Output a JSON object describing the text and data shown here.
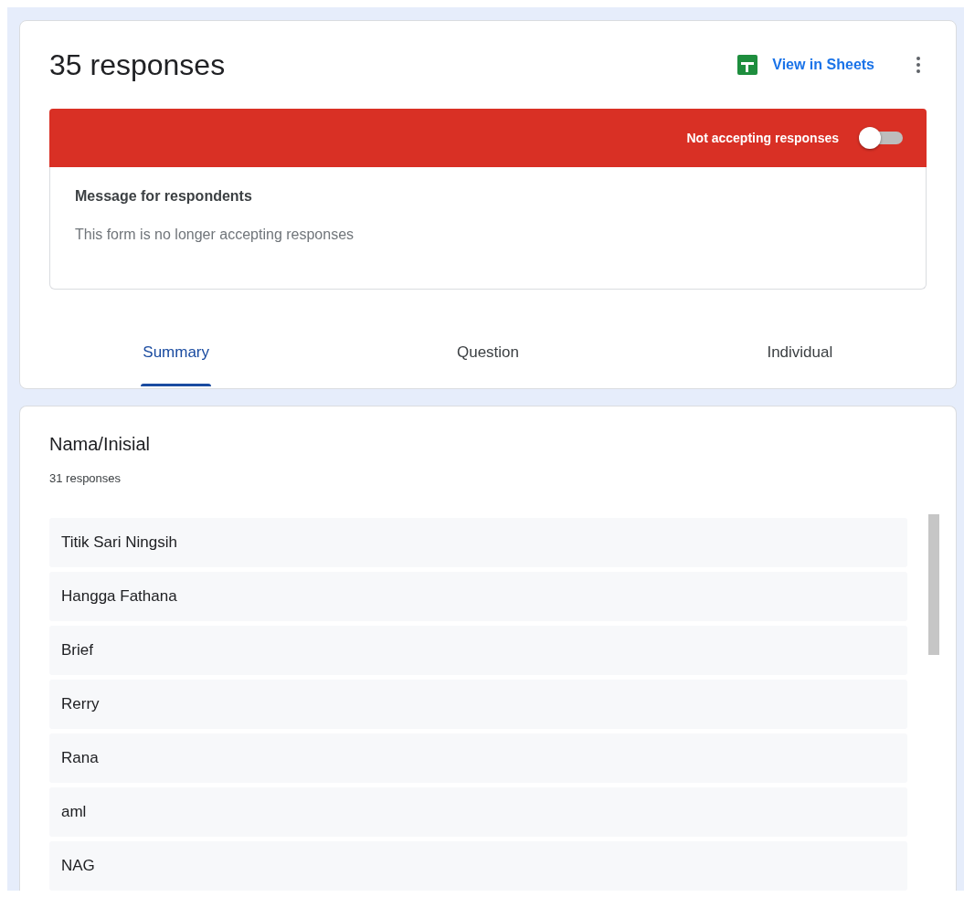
{
  "header": {
    "title": "35 responses",
    "sheets_link": "View in Sheets"
  },
  "banner": {
    "label": "Not accepting responses",
    "on": false
  },
  "message": {
    "label": "Message for respondents",
    "value": "This form is no longer accepting responses"
  },
  "tabs": [
    {
      "label": "Summary",
      "selected": true
    },
    {
      "label": "Question",
      "selected": false
    },
    {
      "label": "Individual",
      "selected": false
    }
  ],
  "question": {
    "title": "Nama/Inisial",
    "count": "31 responses",
    "answers": [
      "Titik Sari Ningsih",
      "Hangga Fathana",
      "Brief",
      "Rerry",
      "Rana",
      "aml",
      "NAG"
    ]
  }
}
